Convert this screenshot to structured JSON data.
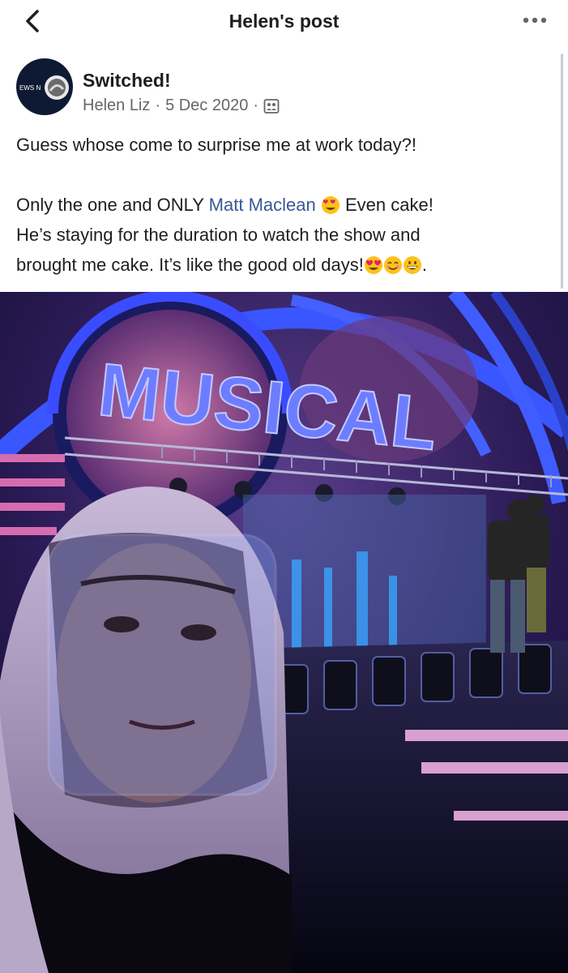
{
  "nav": {
    "title": "Helen's post",
    "back_icon": "chevron-left-icon",
    "more_icon": "more-horizontal-icon"
  },
  "post": {
    "page_name": "Switched!",
    "avatar_text": "EWS N",
    "author": "Helen Liz",
    "separator": "·",
    "date": "5 Dec 2020",
    "audience_icon": "group-audience-icon",
    "line1": "Guess whose come to surprise me at work today?!",
    "line2_before": "Only the one and ONLY ",
    "mention": "Matt Maclean",
    "line2_after": " Even cake!",
    "line3": "He’s staying for the duration to watch the show and",
    "line4": "brought me cake. It’s like the good old days!",
    "line4_end": ".",
    "emojis": [
      "heart-eyes-emoji",
      "smiling-emoji",
      "grinning-emoji"
    ]
  },
  "photo": {
    "stage_sign": "MUSICAL"
  },
  "colors": {
    "mention": "#385898",
    "meta": "#65676b",
    "stage_blue": "#2c3cd8"
  }
}
